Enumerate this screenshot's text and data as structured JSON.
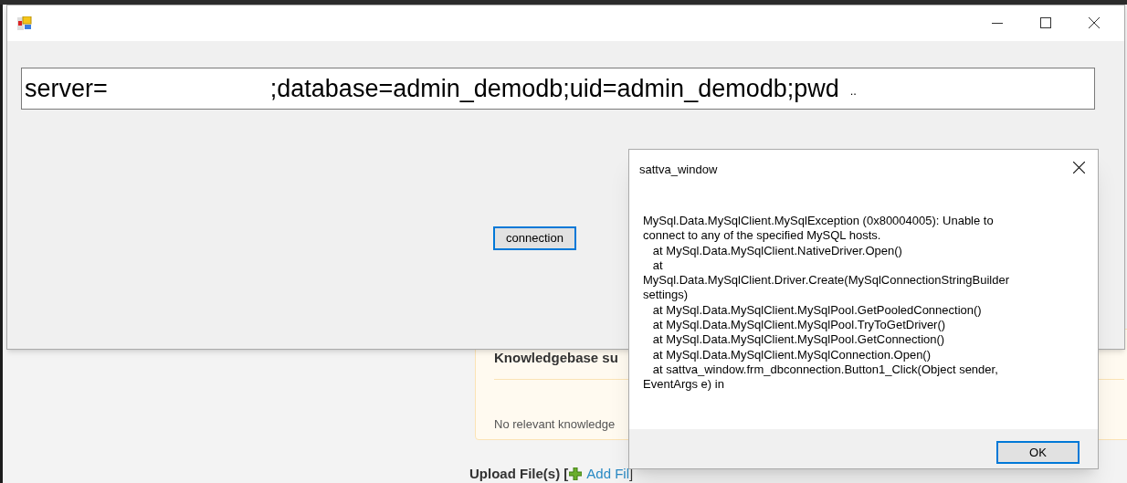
{
  "background_page": {
    "card": {
      "heading": "Knowledgebase su",
      "message": "No relevant knowledge"
    },
    "upload": {
      "label": "Upload File(s) [",
      "link": "Add Fil",
      "bracket": "]"
    }
  },
  "main_window": {
    "connection_string": [
      "server=",
      ";database=admin_demodb;uid=admin_demodb;pwd",
      ".."
    ],
    "button": "connection"
  },
  "dialog": {
    "title": "sattva_window",
    "message": [
      "MySql.Data.MySqlClient.MySqlException (0x80004005): Unable to connect to any of the specified MySQL hosts.",
      "   at MySql.Data.MySqlClient.NativeDriver.Open()",
      "   at MySql.Data.MySqlClient.Driver.Create(MySqlConnectionStringBuilder settings)",
      "   at MySql.Data.MySqlClient.MySqlPool.GetPooledConnection()",
      "   at MySql.Data.MySqlClient.MySqlPool.TryToGetDriver()",
      "   at MySql.Data.MySqlClient.MySqlPool.GetConnection()",
      "   at MySql.Data.MySqlClient.MySqlConnection.Open()",
      "   at sattva_window.frm_dbconnection.Button1_Click(Object sender, EventArgs e) in"
    ],
    "button": "OK"
  }
}
